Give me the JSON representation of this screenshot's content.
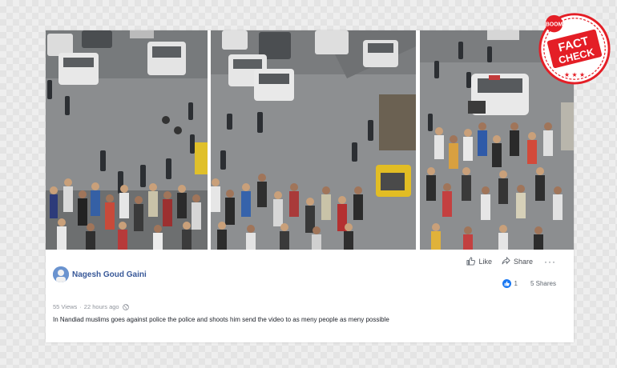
{
  "post": {
    "author": "Nagesh Goud Gaini",
    "views": "55 Views",
    "time": "22 hours ago",
    "text": "In Nandiad muslims goes against police the police and shoots him send the video to as meny people as meny possible",
    "actions": {
      "like": "Like",
      "share": "Share",
      "more": "···"
    },
    "reactions": {
      "count": "1",
      "shares": "5 Shares"
    }
  },
  "video": {
    "frames": [
      "street-frame-1",
      "street-frame-2",
      "street-frame-3"
    ],
    "scene": "crowd of people on a street around police vehicles"
  },
  "stamp": {
    "top": "BOOM",
    "line1": "FACT",
    "line2": "CHECK",
    "color": "#e41e26"
  },
  "icons": {
    "like": "thumbs-up-icon",
    "share": "share-arrow-icon",
    "privacy": "globe-icon",
    "more": "more-dots-icon"
  },
  "colors": {
    "link": "#385898",
    "reaction": "#1877f2",
    "meta": "#90949c"
  }
}
